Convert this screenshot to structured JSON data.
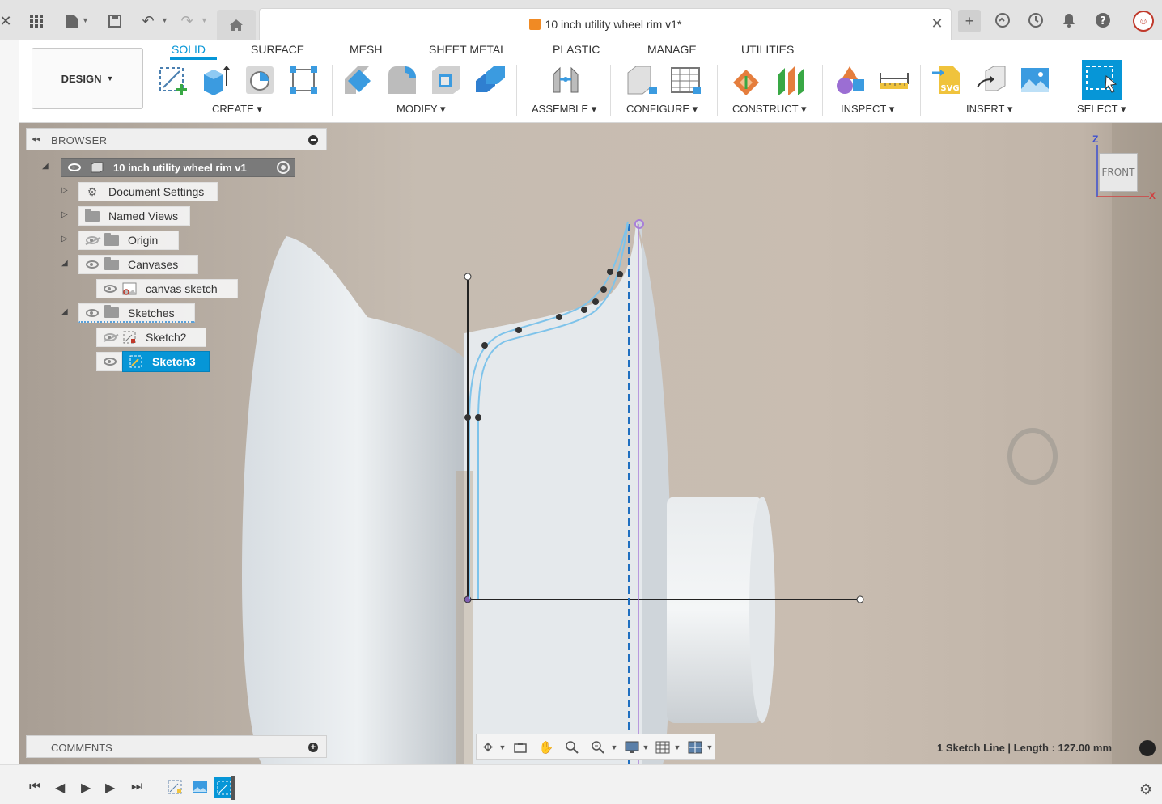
{
  "app": {
    "document_title": "10 inch utility wheel rim v1*",
    "colors": {
      "accent": "#0696d7",
      "selected": "#0696d7",
      "sketch_curve": "#7ec3ea",
      "axis_purple": "#a97fd8"
    }
  },
  "toolbar": {
    "workspace_label": "DESIGN",
    "tabs": [
      {
        "label": "SOLID",
        "active": true
      },
      {
        "label": "SURFACE",
        "active": false
      },
      {
        "label": "MESH",
        "active": false
      },
      {
        "label": "SHEET METAL",
        "active": false
      },
      {
        "label": "PLASTIC",
        "active": false
      },
      {
        "label": "MANAGE",
        "active": false
      },
      {
        "label": "UTILITIES",
        "active": false
      }
    ],
    "groups": [
      {
        "label": "CREATE",
        "icons": [
          "create-sketch-icon",
          "extrude-icon",
          "revolve-icon",
          "pattern-icon"
        ]
      },
      {
        "label": "MODIFY",
        "icons": [
          "press-pull-icon",
          "fillet-icon",
          "shell-icon",
          "combine-icon"
        ]
      },
      {
        "label": "ASSEMBLE",
        "icons": [
          "joint-icon"
        ]
      },
      {
        "label": "CONFIGURE",
        "icons": [
          "configure-icon",
          "table-icon"
        ]
      },
      {
        "label": "CONSTRUCT",
        "icons": [
          "offset-plane-icon",
          "midplane-icon"
        ]
      },
      {
        "label": "INSPECT",
        "icons": [
          "display-component-colors-icon",
          "measure-icon"
        ]
      },
      {
        "label": "INSERT",
        "icons": [
          "insert-svg-icon",
          "insert-derive-icon",
          "insert-canvas-icon"
        ]
      },
      {
        "label": "SELECT",
        "icons": [
          "select-icon"
        ]
      }
    ]
  },
  "browser": {
    "title": "BROWSER",
    "root": "10 inch utility wheel rim v1",
    "items": [
      {
        "label": "Document Settings",
        "icon": "gear-icon"
      },
      {
        "label": "Named Views",
        "icon": "folder-icon"
      },
      {
        "label": "Origin",
        "icon": "folder-icon",
        "visible": false
      },
      {
        "label": "Canvases",
        "icon": "folder-icon",
        "visible": true
      },
      {
        "label": "canvas sketch",
        "icon": "canvas-image-icon",
        "visible": true
      },
      {
        "label": "Sketches",
        "icon": "folder-icon",
        "visible": true
      },
      {
        "label": "Sketch2",
        "icon": "sketch-icon",
        "visible": false
      },
      {
        "label": "Sketch3",
        "icon": "sketch-icon",
        "visible": true,
        "selected": true
      }
    ]
  },
  "viewcube": {
    "face": "FRONT",
    "axis_z": "Z",
    "axis_x": "X"
  },
  "comments": {
    "title": "COMMENTS"
  },
  "status": {
    "text": "1 Sketch Line | Length : 127.00 mm"
  }
}
